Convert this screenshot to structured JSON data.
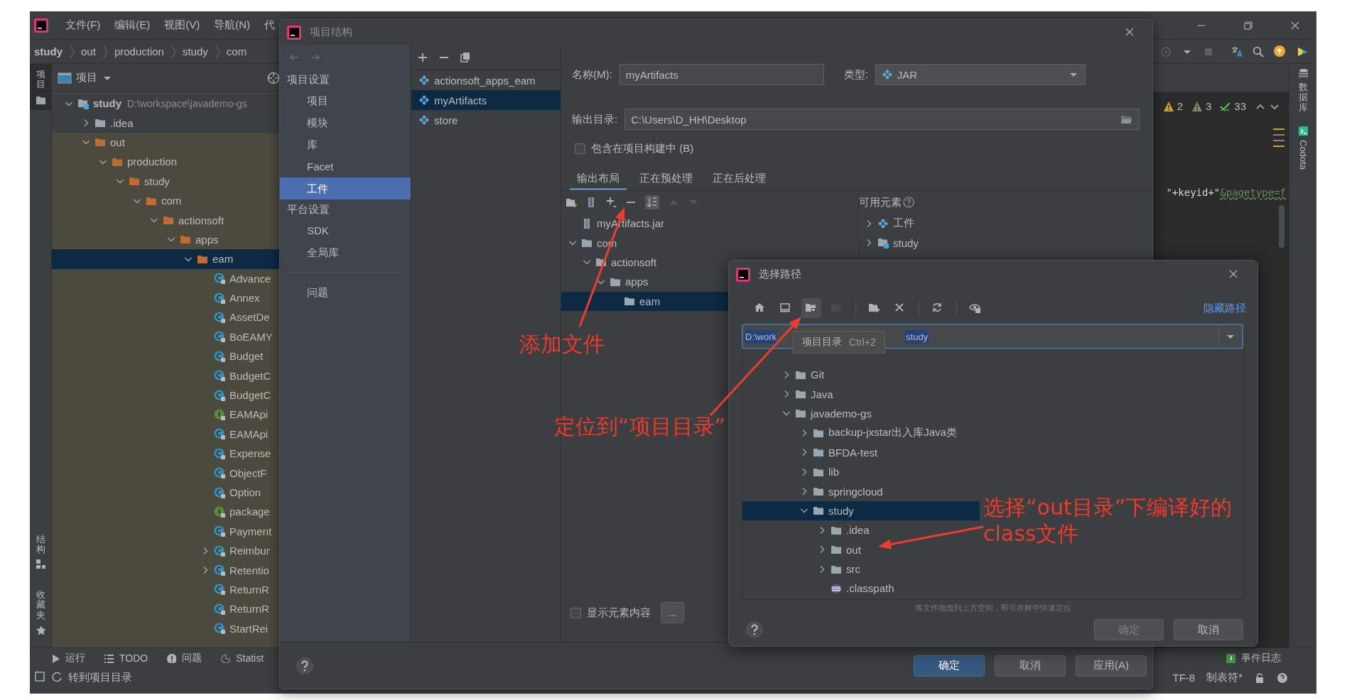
{
  "ide": {
    "menu": [
      {
        "label": "文件(F)"
      },
      {
        "label": "编辑(E)"
      },
      {
        "label": "视图(V)"
      },
      {
        "label": "导航(N)"
      },
      {
        "label": "代"
      }
    ],
    "breadcrumbs": [
      "study",
      "out",
      "production",
      "study",
      "com"
    ],
    "side_tabs": [
      {
        "label": "项目",
        "kind": "project",
        "selected": true
      },
      {
        "label": "结构",
        "kind": "structure",
        "selected": false
      },
      {
        "label": "收藏夹",
        "kind": "favorites",
        "selected": false
      }
    ],
    "project_panel": {
      "title": "项目",
      "tree": [
        {
          "name": "study",
          "kind": "module",
          "path": "D:\\workspace\\javademo-gs",
          "expanded": true,
          "selected": false,
          "children": [
            {
              "name": ".idea",
              "kind": "folder",
              "expanded": false,
              "selected": false
            },
            {
              "name": "out",
              "kind": "folder",
              "excluded": true,
              "expanded": true,
              "selected": false,
              "children": [
                {
                  "name": "production",
                  "kind": "folder",
                  "expanded": true,
                  "selected": false,
                  "children": [
                    {
                      "name": "study",
                      "kind": "folder",
                      "expanded": true,
                      "selected": false,
                      "children": [
                        {
                          "name": "com",
                          "kind": "folder",
                          "expanded": true,
                          "selected": false,
                          "children": [
                            {
                              "name": "actionsoft",
                              "kind": "folder",
                              "expanded": true,
                              "selected": false,
                              "children": [
                                {
                                  "name": "apps",
                                  "kind": "folder",
                                  "expanded": true,
                                  "selected": false,
                                  "children": [
                                    {
                                      "name": "eam",
                                      "kind": "folder",
                                      "expanded": true,
                                      "selected": true,
                                      "children": [
                                        {
                                          "name": "Advance",
                                          "kind": "class",
                                          "selected": false
                                        },
                                        {
                                          "name": "Annex",
                                          "kind": "class",
                                          "selected": false
                                        },
                                        {
                                          "name": "AssetDe",
                                          "kind": "class",
                                          "selected": false
                                        },
                                        {
                                          "name": "BoEAMY",
                                          "kind": "class",
                                          "selected": false
                                        },
                                        {
                                          "name": "Budget",
                                          "kind": "class",
                                          "selected": false
                                        },
                                        {
                                          "name": "BudgetC",
                                          "kind": "class",
                                          "selected": false
                                        },
                                        {
                                          "name": "BudgetC",
                                          "kind": "class",
                                          "selected": false
                                        },
                                        {
                                          "name": "EAMApi",
                                          "kind": "interface",
                                          "selected": false
                                        },
                                        {
                                          "name": "EAMApi",
                                          "kind": "class",
                                          "selected": false
                                        },
                                        {
                                          "name": "Expense",
                                          "kind": "class",
                                          "selected": false
                                        },
                                        {
                                          "name": "ObjectF",
                                          "kind": "class",
                                          "selected": false
                                        },
                                        {
                                          "name": "Option",
                                          "kind": "class",
                                          "selected": false
                                        },
                                        {
                                          "name": "package",
                                          "kind": "interface",
                                          "selected": false
                                        },
                                        {
                                          "name": "Payment",
                                          "kind": "class",
                                          "selected": false
                                        },
                                        {
                                          "name": "Reimbur",
                                          "kind": "class",
                                          "expanded": false,
                                          "selected": false
                                        },
                                        {
                                          "name": "Retentio",
                                          "kind": "class",
                                          "expanded": false,
                                          "selected": false
                                        },
                                        {
                                          "name": "ReturnR",
                                          "kind": "class",
                                          "selected": false
                                        },
                                        {
                                          "name": "ReturnR",
                                          "kind": "class",
                                          "selected": false
                                        },
                                        {
                                          "name": "StartRei",
                                          "kind": "class",
                                          "selected": false
                                        }
                                      ]
                                    }
                                  ]
                                }
                              ]
                            }
                          ]
                        }
                      ]
                    }
                  ]
                }
              ]
            }
          ]
        }
      ]
    },
    "inspections": {
      "warnings": "2",
      "weak_warnings": "3",
      "passed": "33"
    },
    "code_parts": [
      {
        "kind": "plain",
        "text": "\"+keyid+\""
      },
      {
        "kind": "string",
        "text": "&pagetype=f"
      }
    ],
    "right_tabs": [
      {
        "label": "数据库",
        "kind": "database"
      },
      {
        "label": "Codota",
        "kind": "codota"
      }
    ],
    "tool_windows": [
      {
        "kind": "run",
        "label": "运行"
      },
      {
        "kind": "todo",
        "label": "TODO"
      },
      {
        "kind": "problems",
        "label": "问题"
      },
      {
        "kind": "statistic",
        "label": "Statist"
      }
    ],
    "status_message": "转到项目目录",
    "event_log": "事件日志",
    "status_items": [
      "TF-8",
      "制表符*"
    ]
  },
  "project_structure": {
    "title": "项目结构",
    "nav": [
      {
        "kind": "header",
        "label": "项目设置"
      },
      {
        "kind": "item",
        "label": "项目",
        "selected": false
      },
      {
        "kind": "item",
        "label": "模块",
        "selected": false
      },
      {
        "kind": "item",
        "label": "库",
        "selected": false
      },
      {
        "kind": "item",
        "label": "Facet",
        "selected": false
      },
      {
        "kind": "item",
        "label": "工件",
        "selected": true
      },
      {
        "kind": "header",
        "label": "平台设置"
      },
      {
        "kind": "item",
        "label": "SDK",
        "selected": false
      },
      {
        "kind": "item",
        "label": "全局库",
        "selected": false
      },
      {
        "kind": "separator"
      },
      {
        "kind": "item",
        "label": "问题",
        "selected": false
      }
    ],
    "artifacts": [
      {
        "name": "actionsoft_apps_eam",
        "selected": false
      },
      {
        "name": "myArtifacts",
        "selected": true
      },
      {
        "name": "store",
        "selected": false
      }
    ],
    "name_label": "名称(M):",
    "name_value": "myArtifacts",
    "type_label": "类型:",
    "type_value": "JAR",
    "output_label": "输出目录:",
    "output_value": "C:\\Users\\D_HH\\Desktop",
    "include_in_build": {
      "label": "包含在项目构建中 (B)",
      "checked": false
    },
    "tabs": [
      {
        "label": "输出布局",
        "selected": true
      },
      {
        "label": "正在预处理",
        "selected": false
      },
      {
        "label": "正在后处理",
        "selected": false
      }
    ],
    "layout_tree": [
      {
        "name": "myArtifacts.jar",
        "kind": "jar",
        "selected": false
      },
      {
        "name": "com",
        "kind": "folder",
        "expanded": true,
        "selected": false,
        "children": [
          {
            "name": "actionsoft",
            "kind": "folder",
            "expanded": true,
            "selected": false,
            "children": [
              {
                "name": "apps",
                "kind": "folder",
                "expanded": true,
                "selected": false,
                "children": [
                  {
                    "name": "eam",
                    "kind": "folder",
                    "selected": true
                  }
                ]
              }
            ]
          }
        ]
      }
    ],
    "available_label": "可用元素",
    "available": [
      {
        "name": "工件",
        "kind": "artifact",
        "expanded": false
      },
      {
        "name": "study",
        "kind": "module",
        "expanded": false
      }
    ],
    "show_content": {
      "label": "显示元素内容",
      "checked": false
    },
    "more_button": "...",
    "buttons": [
      {
        "label": "确定",
        "primary": true
      },
      {
        "label": "取消",
        "primary": false
      },
      {
        "label": "应用(A)",
        "primary": false
      }
    ]
  },
  "choose_path": {
    "title": "选择路径",
    "toolbar": [
      {
        "kind": "home",
        "highlighted": false,
        "disabled": false
      },
      {
        "kind": "desktop",
        "highlighted": false,
        "disabled": false
      },
      {
        "kind": "project",
        "highlighted": true,
        "disabled": false
      },
      {
        "kind": "module",
        "highlighted": false,
        "disabled": true
      },
      {
        "kind": "new_folder",
        "highlighted": false,
        "disabled": false
      },
      {
        "kind": "delete",
        "highlighted": false,
        "disabled": false
      },
      {
        "kind": "refresh",
        "highlighted": false,
        "disabled": false
      },
      {
        "kind": "hidden",
        "highlighted": false,
        "disabled": false
      }
    ],
    "hide_path_link": "隐藏路径",
    "path_parts": [
      "D:\\work",
      "study"
    ],
    "tooltip": {
      "label": "项目目录",
      "shortcut": "Ctrl+2"
    },
    "tree": [
      {
        "name": "Git",
        "kind": "folder",
        "expanded": false,
        "selected": false
      },
      {
        "name": "Java",
        "kind": "folder",
        "expanded": false,
        "selected": false
      },
      {
        "name": "javademo-gs",
        "kind": "folder",
        "expanded": true,
        "selected": false,
        "children": [
          {
            "name": "backup-jxstar出入库Java类",
            "kind": "folder",
            "expanded": false,
            "selected": false
          },
          {
            "name": "BFDA-test",
            "kind": "folder",
            "expanded": false,
            "selected": false
          },
          {
            "name": "lib",
            "kind": "folder",
            "expanded": false,
            "selected": false
          },
          {
            "name": "springcloud",
            "kind": "folder",
            "expanded": false,
            "selected": false
          },
          {
            "name": "study",
            "kind": "folder",
            "expanded": true,
            "selected": true,
            "children": [
              {
                "name": ".idea",
                "kind": "folder",
                "expanded": false,
                "selected": false
              },
              {
                "name": "out",
                "kind": "folder",
                "expanded": false,
                "selected": false
              },
              {
                "name": "src",
                "kind": "folder",
                "expanded": false,
                "selected": false
              },
              {
                "name": ".classpath",
                "kind": "file",
                "selected": false
              }
            ]
          }
        ]
      }
    ],
    "hint": "将文件拖放到上方空间，即可在树中快速定位",
    "buttons": [
      {
        "label": "确定",
        "disabled": true
      },
      {
        "label": "取消",
        "disabled": false
      }
    ]
  },
  "annotations": [
    {
      "lines": [
        "添加文件"
      ]
    },
    {
      "lines": [
        "定位到“项目目录”"
      ]
    },
    {
      "lines": [
        "选择“out目录”下编译好的",
        "class文件"
      ]
    }
  ]
}
